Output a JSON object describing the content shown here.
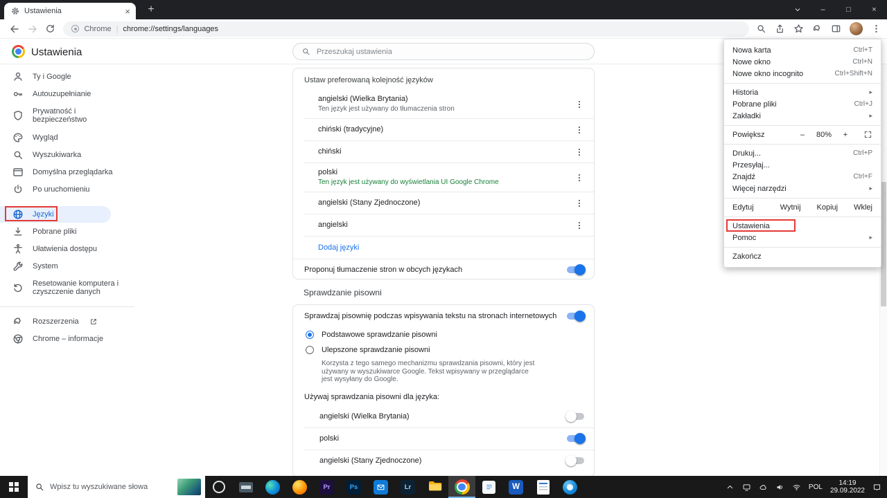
{
  "window": {
    "tab_title": "Ustawienia",
    "controls": {
      "minimize": "–",
      "maximize": "□",
      "close": "×",
      "tab_close": "×",
      "new_tab": "+"
    }
  },
  "toolbar": {
    "origin": "Chrome",
    "separator": "|",
    "url": "chrome://settings/languages"
  },
  "header": {
    "title": "Ustawienia",
    "search_placeholder": "Przeszukaj ustawienia"
  },
  "sidebar": {
    "items": [
      {
        "label": "Ty i Google"
      },
      {
        "label": "Autouzupełnianie"
      },
      {
        "label": "Prywatność i bezpieczeństwo"
      },
      {
        "label": "Wygląd"
      },
      {
        "label": "Wyszukiwarka"
      },
      {
        "label": "Domyślna przeglądarka"
      },
      {
        "label": "Po uruchomieniu"
      },
      {
        "label": "Języki",
        "selected": true
      },
      {
        "label": "Pobrane pliki"
      },
      {
        "label": "Ułatwienia dostępu"
      },
      {
        "label": "System"
      },
      {
        "label": "Resetowanie komputera i czyszczenie danych"
      },
      {
        "label": "Rozszerzenia",
        "external": true
      },
      {
        "label": "Chrome – informacje"
      }
    ]
  },
  "languages": {
    "order_header": "Ustaw preferowaną kolejność języków",
    "rows": [
      {
        "name": "angielski (Wielka Brytania)",
        "subtitle": "Ten język jest używany do tłumaczenia stron"
      },
      {
        "name": "chiński (tradycyjne)"
      },
      {
        "name": "chiński"
      },
      {
        "name": "polski",
        "subtitle": "Ten język jest używany do wyświetlania UI Google Chrome",
        "subtitle_color": "#188038"
      },
      {
        "name": "angielski (Stany Zjednoczone)"
      },
      {
        "name": "angielski"
      }
    ],
    "add_link": "Dodaj języki",
    "translate_label": "Proponuj tłumaczenie stron w obcych językach",
    "translate_on": true
  },
  "spellcheck": {
    "section_title": "Sprawdzanie pisowni",
    "main_label": "Sprawdzaj pisownię podczas wpisywania tekstu na stronach internetowych",
    "main_on": true,
    "radios": [
      {
        "label": "Podstawowe sprawdzanie pisowni",
        "checked": true
      },
      {
        "label": "Ulepszone sprawdzanie pisowni",
        "checked": false,
        "description": "Korzysta z tego samego mechanizmu sprawdzania pisowni, który jest używany w wyszukiwarce Google. Tekst wpisywany w przeglądarce jest wysyłany do Google."
      }
    ],
    "use_for_label": "Używaj sprawdzania pisowni dla języka:",
    "languages": [
      {
        "name": "angielski (Wielka Brytania)",
        "enabled": false
      },
      {
        "name": "polski",
        "enabled": true
      },
      {
        "name": "angielski (Stany Zjednoczone)",
        "enabled": false
      }
    ]
  },
  "menu": {
    "items": [
      {
        "label": "Nowa karta",
        "shortcut": "Ctrl+T"
      },
      {
        "label": "Nowe okno",
        "shortcut": "Ctrl+N"
      },
      {
        "label": "Nowe okno incognito",
        "shortcut": "Ctrl+Shift+N"
      },
      {
        "label": "Historia",
        "submenu": true
      },
      {
        "label": "Pobrane pliki",
        "shortcut": "Ctrl+J"
      },
      {
        "label": "Zakładki",
        "submenu": true
      },
      {
        "label": "Powiększ",
        "zoom_out": "–",
        "zoom_value": "80%",
        "zoom_in": "+"
      },
      {
        "label": "Drukuj...",
        "shortcut": "Ctrl+P"
      },
      {
        "label": "Przesyłaj..."
      },
      {
        "label": "Znajdź",
        "shortcut": "Ctrl+F"
      },
      {
        "label": "Więcej narzędzi",
        "submenu": true
      },
      {
        "label": "Edytuj",
        "actions": [
          "Wytnij",
          "Kopiuj",
          "Wklej"
        ]
      },
      {
        "label": "Ustawienia",
        "annotated": true
      },
      {
        "label": "Pomoc",
        "submenu": true
      },
      {
        "label": "Zakończ"
      }
    ]
  },
  "taskbar": {
    "search_placeholder": "Wpisz tu wyszukiwane słowa",
    "apps": [
      {
        "name": "cortana"
      },
      {
        "name": "task-view"
      },
      {
        "name": "edge"
      },
      {
        "name": "firefox"
      },
      {
        "name": "premiere",
        "glyph": "Pr"
      },
      {
        "name": "photoshop",
        "glyph": "Ps"
      },
      {
        "name": "mail"
      },
      {
        "name": "lightroom",
        "glyph": "Lr"
      },
      {
        "name": "file-explorer"
      },
      {
        "name": "chrome",
        "active": true
      },
      {
        "name": "notes"
      },
      {
        "name": "word",
        "glyph": "W"
      },
      {
        "name": "document"
      },
      {
        "name": "messaging"
      }
    ],
    "tray": {
      "language": "POL",
      "time": "14:19",
      "date": "29.09.2022"
    }
  },
  "colors": {
    "accent": "#1a73e8",
    "selected_bg": "#e8f0fe",
    "link": "#1a73e8",
    "green_status": "#188038",
    "annotation_red": "#e53935",
    "toggle_on_track": "#8ab4f8"
  }
}
